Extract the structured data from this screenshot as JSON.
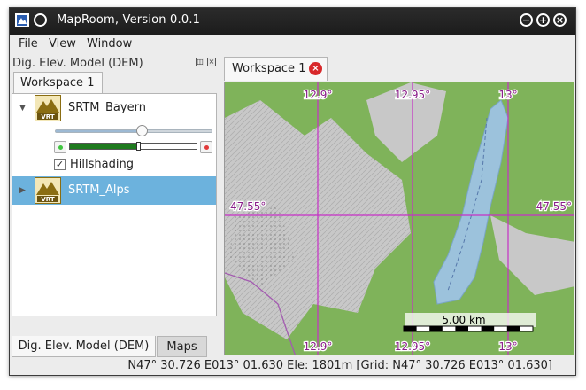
{
  "window": {
    "title": "MapRoom, Version 0.0.1",
    "controls": {
      "minimize": "−",
      "maximize": "+",
      "close": "×"
    }
  },
  "menu": {
    "items": [
      "File",
      "View",
      "Window"
    ]
  },
  "dock": {
    "title": "Dig. Elev. Model (DEM)",
    "workspace_tab": "Workspace 1",
    "layers": [
      {
        "name": "SRTM_Bayern",
        "icon": "vrt-terrain-icon",
        "badge": "VRT",
        "expanded": true
      },
      {
        "name": "SRTM_Alps",
        "icon": "vrt-terrain-icon",
        "badge": "VRT",
        "expanded": false,
        "selected": true
      }
    ],
    "opacity_level": 0.55,
    "range": {
      "low": 0.0,
      "high": 0.53
    },
    "hillshading_label": "Hillshading",
    "hillshading_checked": true,
    "check_glyph": "✓",
    "bottom_tabs": [
      "Dig. Elev. Model (DEM)",
      "Maps"
    ]
  },
  "map": {
    "tab_label": "Workspace 1",
    "top_labels": [
      "12.9°",
      "12.95°",
      "13°"
    ],
    "bottom_labels": [
      "12.9°",
      "12.95°",
      "13°"
    ],
    "lat_label_left": "47.55°",
    "lat_label_right": "47.55°",
    "scale_label": "5.00 km"
  },
  "status": {
    "text": "N47° 30.726 E013° 01.630  Ele: 1801m [Grid: N47° 30.726 E013° 01.630]"
  },
  "colors": {
    "grid": "#c62fc6",
    "grid_label": "#8a1e8a",
    "forest": "#7fb35a",
    "rock": "#c8c8c8",
    "lake": "#9cc2dc",
    "selection": "#6cb2dd",
    "range_fill": "#1e7a1e"
  }
}
